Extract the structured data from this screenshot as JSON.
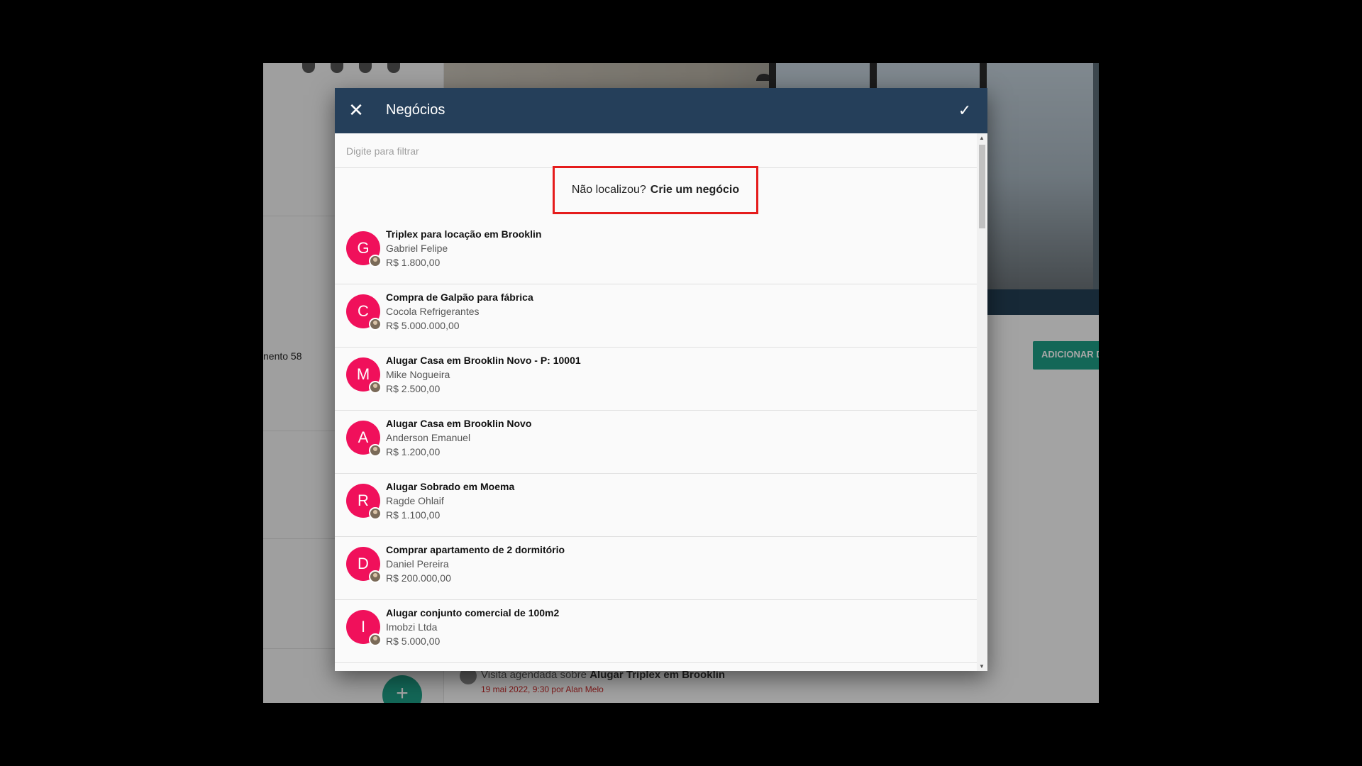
{
  "background": {
    "partial_text": "nento 58",
    "add_button_label": "ADICIONAR D",
    "timeline_text": "Visita agendada sobre",
    "timeline_link": "Alugar Triplex em Brooklin",
    "timeline_date": "19 mai 2022, 9:30 por Alan Melo"
  },
  "dialog": {
    "title": "Negócios",
    "filter_placeholder": "Digite para filtrar",
    "create_prompt": "Não localizou?",
    "create_link": "Crie um negócio"
  },
  "deals": [
    {
      "initial": "G",
      "title": "Triplex para locação em Brooklin",
      "client": "Gabriel Felipe",
      "price": "R$ 1.800,00"
    },
    {
      "initial": "C",
      "title": "Compra de Galpão para fábrica",
      "client": "Cocola Refrigerantes",
      "price": "R$ 5.000.000,00"
    },
    {
      "initial": "M",
      "title": "Alugar Casa em Brooklin Novo - P: 10001",
      "client": "Mike Nogueira",
      "price": "R$ 2.500,00"
    },
    {
      "initial": "A",
      "title": "Alugar Casa em Brooklin Novo",
      "client": "Anderson Emanuel",
      "price": "R$ 1.200,00"
    },
    {
      "initial": "R",
      "title": "Alugar Sobrado em Moema",
      "client": "Ragde Ohlaif",
      "price": "R$ 1.100,00"
    },
    {
      "initial": "D",
      "title": "Comprar apartamento de 2 dormitório",
      "client": "Daniel Pereira",
      "price": "R$ 200.000,00"
    },
    {
      "initial": "I",
      "title": "Alugar conjunto comercial de 100m2",
      "client": "Imobzi Ltda",
      "price": "R$ 5.000,00"
    },
    {
      "initial": "",
      "title": "Alugar Triplex em Brooklin",
      "client": "",
      "price": ""
    }
  ],
  "colors": {
    "header": "#253f5a",
    "avatar": "#f0105b",
    "highlight": "#e51c1c",
    "accent": "#1e9e86"
  },
  "icons": {
    "close": "close-icon",
    "confirm": "check-icon",
    "fab": "plus-icon"
  }
}
